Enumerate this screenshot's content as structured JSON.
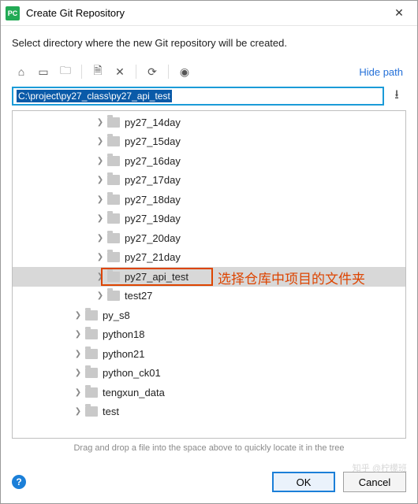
{
  "window": {
    "title": "Create Git Repository",
    "app_icon_text": "PC"
  },
  "instruction": "Select directory where the new Git repository will be created.",
  "toolbar": {
    "icons": [
      "home-icon",
      "module-icon",
      "new-folder-icon",
      "copy-icon",
      "delete-icon",
      "refresh-icon",
      "show-hidden-icon"
    ],
    "hide_path_label": "Hide path"
  },
  "path": {
    "value": "C:\\project\\py27_class\\py27_api_test"
  },
  "tree": {
    "nodes": [
      {
        "label": "py27_14day",
        "depth": 3,
        "expandable": true,
        "selected": false
      },
      {
        "label": "py27_15day",
        "depth": 3,
        "expandable": true,
        "selected": false
      },
      {
        "label": "py27_16day",
        "depth": 3,
        "expandable": true,
        "selected": false
      },
      {
        "label": "py27_17day",
        "depth": 3,
        "expandable": true,
        "selected": false
      },
      {
        "label": "py27_18day",
        "depth": 3,
        "expandable": true,
        "selected": false
      },
      {
        "label": "py27_19day",
        "depth": 3,
        "expandable": true,
        "selected": false
      },
      {
        "label": "py27_20day",
        "depth": 3,
        "expandable": true,
        "selected": false
      },
      {
        "label": "py27_21day",
        "depth": 3,
        "expandable": true,
        "selected": false
      },
      {
        "label": "py27_api_test",
        "depth": 3,
        "expandable": true,
        "selected": true
      },
      {
        "label": "test27",
        "depth": 3,
        "expandable": true,
        "selected": false
      },
      {
        "label": "py_s8",
        "depth": 2,
        "expandable": true,
        "selected": false
      },
      {
        "label": "python18",
        "depth": 2,
        "expandable": true,
        "selected": false
      },
      {
        "label": "python21",
        "depth": 2,
        "expandable": true,
        "selected": false
      },
      {
        "label": "python_ck01",
        "depth": 2,
        "expandable": true,
        "selected": false
      },
      {
        "label": "tengxun_data",
        "depth": 2,
        "expandable": true,
        "selected": false
      },
      {
        "label": "test",
        "depth": 2,
        "expandable": true,
        "selected": false
      }
    ]
  },
  "annotation": {
    "text": "选择仓库中项目的文件夹"
  },
  "hint": "Drag and drop a file into the space above to quickly locate it in the tree",
  "buttons": {
    "ok": "OK",
    "cancel": "Cancel"
  },
  "watermark": "知乎 @柠檬班"
}
